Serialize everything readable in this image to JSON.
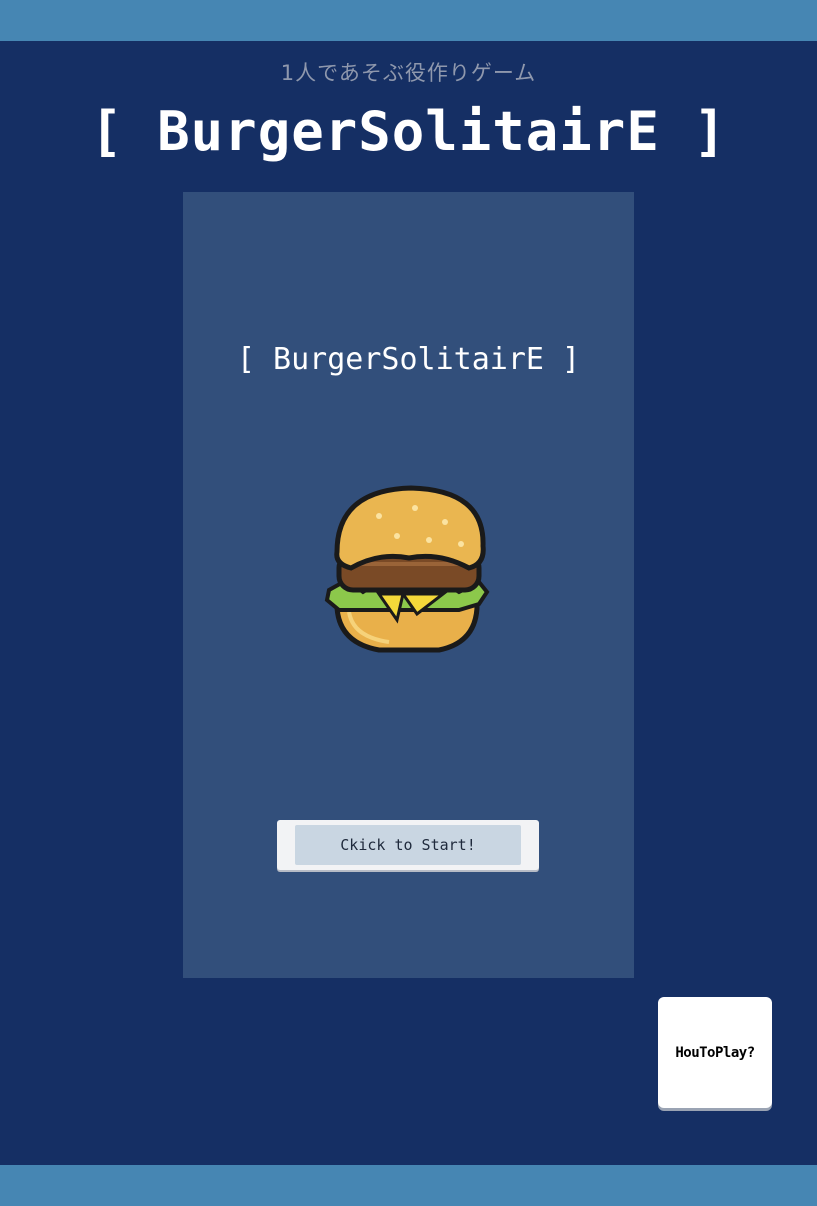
{
  "header": {
    "subtitle": "1人であそぶ役作りゲーム",
    "title": "[ BurgerSolitairE ]"
  },
  "panel": {
    "title": "[ BurgerSolitairE ]",
    "logo_icon": "burger-icon",
    "start_label": "Ckick to Start!"
  },
  "howto": {
    "label": "HouToPlay?"
  },
  "colors": {
    "background": "#152f64",
    "bars": "#4686b3",
    "panel": "#324f7b"
  }
}
